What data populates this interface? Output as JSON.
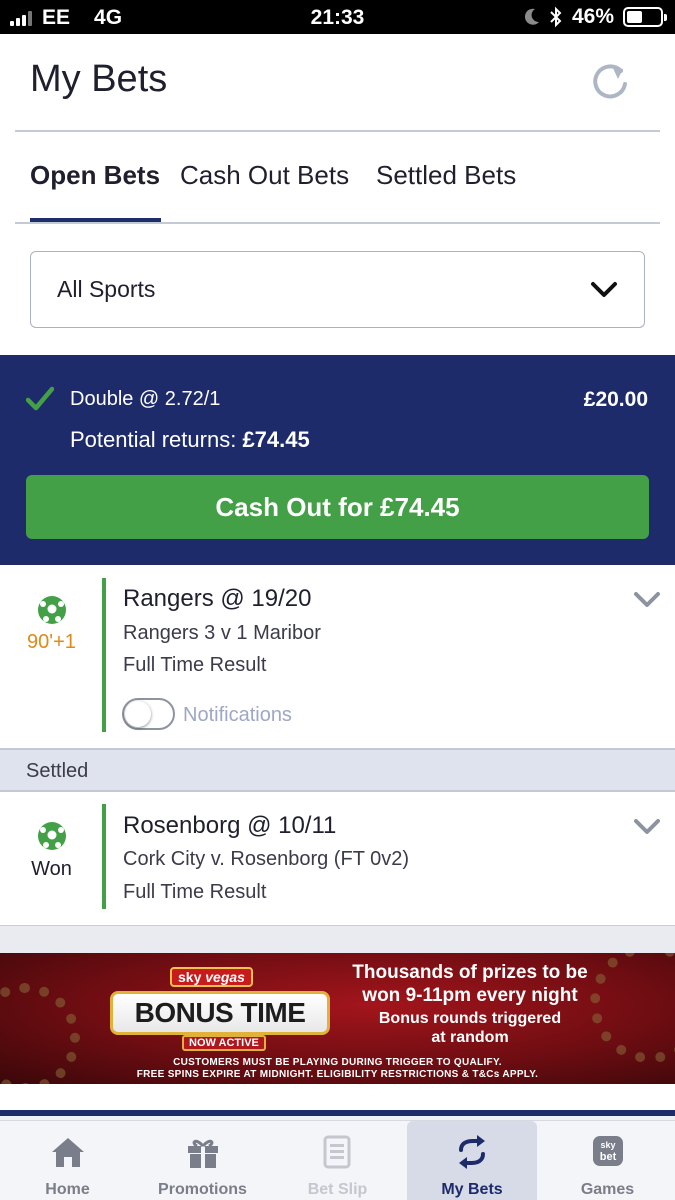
{
  "status_bar": {
    "carrier": "EE",
    "network": "4G",
    "time": "21:33",
    "battery": "46%"
  },
  "header": {
    "title": "My Bets",
    "refresh_icon": "refresh-icon"
  },
  "tabs": [
    {
      "label": "Open Bets",
      "active": true
    },
    {
      "label": "Cash Out Bets",
      "active": false
    },
    {
      "label": "Settled Bets",
      "active": false
    }
  ],
  "filter": {
    "selected": "All Sports"
  },
  "bet": {
    "type": "Double @ 2.72/1",
    "stake": "£20.00",
    "returns_label": "Potential returns:",
    "returns_value": "£74.45",
    "cashout_label": "Cash Out for £74.45"
  },
  "selections": [
    {
      "minute": "90'",
      "added_time": "+1",
      "title": "Rangers @ 19/20",
      "match": "Rangers 3 v 1 Maribor",
      "market": "Full Time Result",
      "notifications_label": "Notifications",
      "notifications_on": false
    }
  ],
  "settled_section": {
    "heading": "Settled",
    "selection": {
      "status": "Won",
      "title": "Rosenborg @ 10/11",
      "match": "Cork City v. Rosenborg (FT 0v2)",
      "market": "Full Time Result"
    }
  },
  "banner": {
    "brand_sky": "sky",
    "brand_vegas": "vegas",
    "logo_text": "BONUS TIME",
    "badge": "NOW ACTIVE",
    "headline_1": "Thousands of prizes to be",
    "headline_2": "won 9-11pm every night",
    "subline_1": "Bonus rounds triggered",
    "subline_2": "at random",
    "terms_1": "CUSTOMERS MUST BE PLAYING DURING TRIGGER TO QUALIFY.",
    "terms_2": "FREE SPINS EXPIRE AT MIDNIGHT. ELIGIBILITY RESTRICTIONS & T&Cs APPLY."
  },
  "bottom_nav": [
    {
      "label": "Home",
      "icon": "home-icon"
    },
    {
      "label": "Promotions",
      "icon": "gift-icon"
    },
    {
      "label": "Bet Slip",
      "icon": "betslip-icon"
    },
    {
      "label": "My Bets",
      "icon": "swap-arrows-icon"
    },
    {
      "label": "Games",
      "icon": "skybet-icon",
      "badge_1": "sky",
      "badge_2": "bet"
    }
  ],
  "colors": {
    "navy": "#1e2b6b",
    "green": "#43a047",
    "amber": "#e08a16"
  }
}
